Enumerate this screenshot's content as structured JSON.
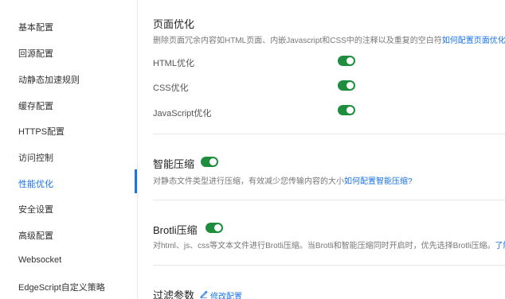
{
  "sidebar": {
    "items": [
      {
        "label": "基本配置"
      },
      {
        "label": "回源配置"
      },
      {
        "label": "动静态加速规则"
      },
      {
        "label": "缓存配置"
      },
      {
        "label": "HTTPS配置"
      },
      {
        "label": "访问控制"
      },
      {
        "label": "性能优化"
      },
      {
        "label": "安全设置"
      },
      {
        "label": "高级配置"
      },
      {
        "label": "Websocket"
      },
      {
        "label": "EdgeScript自定义策略"
      }
    ]
  },
  "page_optimize": {
    "title": "页面优化",
    "desc": "删除页面冗余内容如HTML页面、内嵌Javascript和CSS中的注释以及重复的空白符",
    "link": "如何配置页面优化?",
    "options": [
      {
        "label": "HTML优化",
        "enabled": true
      },
      {
        "label": "CSS优化",
        "enabled": true
      },
      {
        "label": "JavaScript优化",
        "enabled": true
      }
    ]
  },
  "smart_compress": {
    "title": "智能压缩",
    "enabled": true,
    "desc": "对静态文件类型进行压缩，有效减少您传输内容的大小",
    "link": "如何配置智能压缩?"
  },
  "brotli": {
    "title": "Brotli压缩",
    "enabled": true,
    "desc": "对html、js、css等文本文件进行Brotli压缩。当Brotli和智能压缩同时开启时，优先选择Brotli压缩。",
    "link": "了解"
  },
  "filter_params": {
    "title": "过滤参数",
    "edit_label": "修改配置"
  },
  "colors": {
    "accent": "#1a73e8",
    "toggle_on": "#1e8e3e"
  }
}
